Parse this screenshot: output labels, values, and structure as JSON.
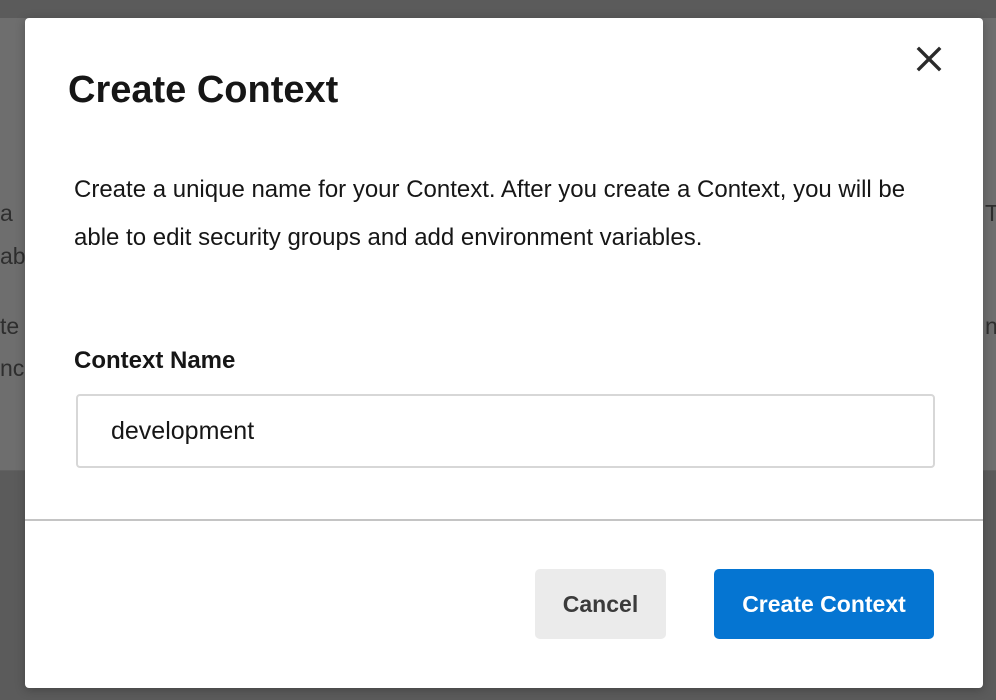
{
  "background": {
    "fragments": [
      "a",
      "ab",
      "te",
      "nc",
      "Th",
      "ne"
    ]
  },
  "modal": {
    "title": "Create Context",
    "description": "Create a unique name for your Context. After you create a Context, you will be able to edit security groups and add environment variables.",
    "field": {
      "label": "Context Name",
      "value": "development"
    },
    "buttons": {
      "cancel": "Cancel",
      "submit": "Create Context"
    },
    "colors": {
      "primary": "#0575d2",
      "secondary": "#ebebeb"
    }
  }
}
